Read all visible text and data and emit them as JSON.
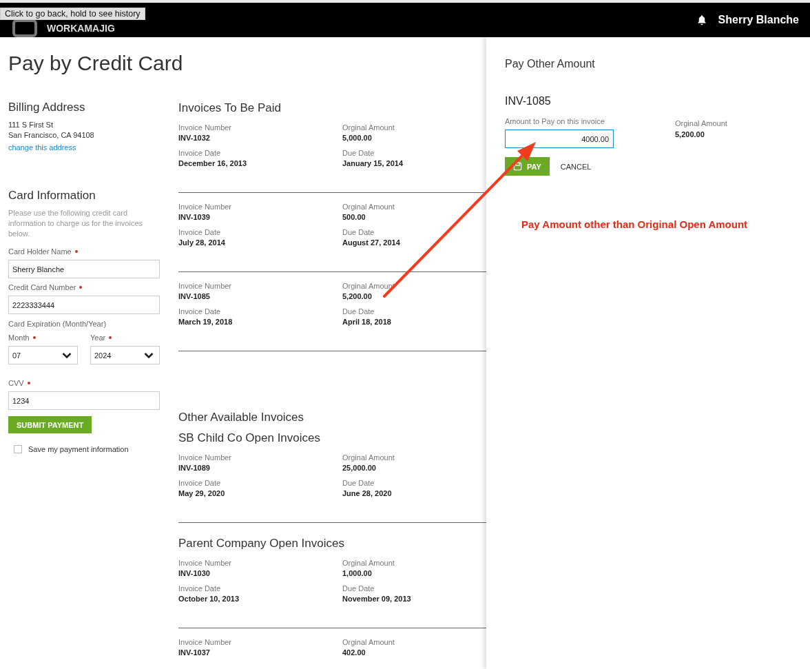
{
  "browser_tooltip": "Click to go back, hold to see history",
  "header": {
    "logo": "WORKAMAJIG",
    "user": "Sherry Blanche"
  },
  "page_title": "Pay by Credit Card",
  "billing": {
    "title": "Billing Address",
    "address_lines": [
      "111 S First St",
      "San Francisco, CA  94108"
    ],
    "link": "change this address"
  },
  "card": {
    "title": "Card Information",
    "help": "Please use the following credit card information to charge us for the invoices below.",
    "holder": {
      "label": "Card Holder Name",
      "required": true,
      "value": "Sherry Blanche"
    },
    "number": {
      "label": "Credit Card Number",
      "required": true,
      "value": "2223333444"
    },
    "expiration": {
      "label": "Card Expiration (Month/Year)",
      "month": {
        "label": "Month",
        "required": true,
        "value": "07"
      },
      "year": {
        "label": "Year",
        "required": true,
        "value": "2024"
      }
    },
    "cvv": {
      "label": "CVV",
      "required": true,
      "value": "1234"
    },
    "submit": "SUBMIT PAYMENT",
    "save": {
      "label": "Save my payment information",
      "checked": false
    }
  },
  "invoices_to_pay": {
    "title": "Invoices To Be Paid",
    "invoices": [
      {
        "number_label": "Invoice Number",
        "number": "INV-1032",
        "amount_label": "Orginal Amount",
        "amount": "5,000.00",
        "date_label": "Invoice Date",
        "date": "December 16, 2013",
        "due_label": "Due Date",
        "due": "January 15, 2014"
      },
      {
        "number_label": "Invoice Number",
        "number": "INV-1039",
        "amount_label": "Orginal Amount",
        "amount": "500.00",
        "date_label": "Invoice Date",
        "date": "July 28, 2014",
        "due_label": "Due Date",
        "due": "August 27, 2014"
      },
      {
        "number_label": "Invoice Number",
        "number": "INV-1085",
        "amount_label": "Orginal Amount",
        "amount": "5,200.00",
        "date_label": "Invoice Date",
        "date": "March 19, 2018",
        "due_label": "Due Date",
        "due": "April 18, 2018"
      }
    ]
  },
  "other": {
    "title": "Other Available Invoices",
    "groups": [
      {
        "title": "SB Child Co Open Invoices",
        "invoices": [
          {
            "number_label": "Invoice Number",
            "number": "INV-1089",
            "amount_label": "Orginal Amount",
            "amount": "25,000.00",
            "date_label": "Invoice Date",
            "date": "May 29, 2020",
            "due_label": "Due Date",
            "due": "June 28, 2020"
          }
        ]
      },
      {
        "title": "Parent Company Open Invoices",
        "invoices": [
          {
            "number_label": "Invoice Number",
            "number": "INV-1030",
            "amount_label": "Orginal Amount",
            "amount": "1,000.00",
            "date_label": "Invoice Date",
            "date": "October 10, 2013",
            "due_label": "Due Date",
            "due": "November 09, 2013"
          },
          {
            "number_label": "Invoice Number",
            "number": "INV-1037",
            "amount_label": "Orginal Amount",
            "amount": "402.00"
          }
        ]
      }
    ]
  },
  "panel": {
    "title": "Pay Other Amount",
    "invoice": "INV-1085",
    "amount_label": "Amount to Pay on this invoice",
    "amount_value": "4000.00",
    "original_label": "Orginal Amount",
    "original": "5,200.00",
    "pay": "PAY",
    "cancel": "CANCEL"
  },
  "annotation": "Pay Amount other than Original Open Amount"
}
